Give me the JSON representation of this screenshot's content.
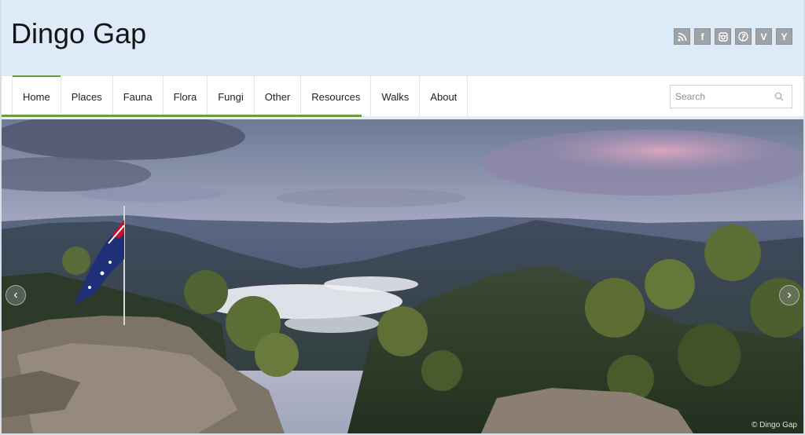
{
  "site": {
    "title": "Dingo Gap"
  },
  "social": [
    {
      "name": "rss",
      "glyph": ""
    },
    {
      "name": "facebook",
      "glyph": "f"
    },
    {
      "name": "instagram",
      "glyph": ""
    },
    {
      "name": "pinterest",
      "glyph": ""
    },
    {
      "name": "vimeo",
      "glyph": "V"
    },
    {
      "name": "yelp",
      "glyph": "Y"
    }
  ],
  "nav": {
    "items": [
      "Home",
      "Places",
      "Fauna",
      "Flora",
      "Fungi",
      "Other",
      "Resources",
      "Walks",
      "About"
    ],
    "active": "Home"
  },
  "search": {
    "placeholder": "Search"
  },
  "slider": {
    "credit": "© Dingo Gap",
    "prev_glyph": "‹",
    "next_glyph": "›"
  },
  "colors": {
    "accent": "#6a9b3c",
    "header_bg": "#ddeaf7"
  }
}
